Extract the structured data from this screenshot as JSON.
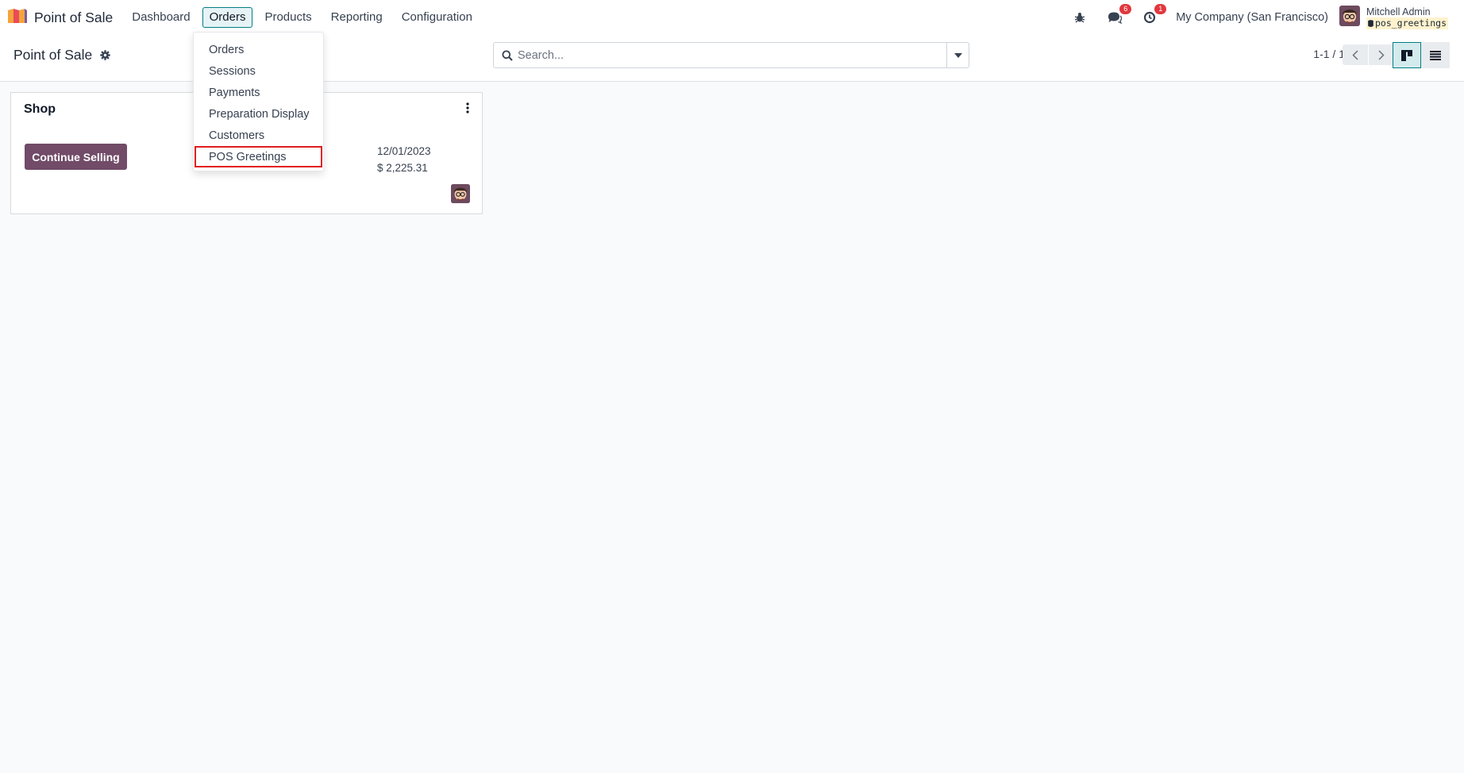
{
  "app": {
    "title": "Point of Sale",
    "logo": "pos-app-icon"
  },
  "menu": [
    {
      "label": "Dashboard",
      "active": false
    },
    {
      "label": "Orders",
      "active": true
    },
    {
      "label": "Products",
      "active": false
    },
    {
      "label": "Reporting",
      "active": false
    },
    {
      "label": "Configuration",
      "active": false
    }
  ],
  "systray": {
    "debug_icon": "bug-icon",
    "messages_icon": "chat-icon",
    "messages_count": "6",
    "activity_icon": "clock-icon",
    "activity_count": "1",
    "company": "My Company (San Francisco)",
    "user_name": "Mitchell Admin",
    "database": "pos_greetings"
  },
  "control_panel": {
    "title": "Point of Sale",
    "search_placeholder": "Search...",
    "pager": "1-1 / 1",
    "views": [
      "kanban",
      "list"
    ],
    "active_view": "kanban"
  },
  "orders_dropdown": {
    "items": [
      "Orders",
      "Sessions",
      "Payments",
      "Preparation Display",
      "Customers",
      "POS Greetings"
    ],
    "highlighted": "POS Greetings"
  },
  "card": {
    "title": "Shop",
    "action_label": "Continue Selling",
    "date": "12/01/2023",
    "amount": "$ 2,225.31"
  },
  "colors": {
    "primary": "#714b67",
    "accent": "#017e84",
    "badge": "#e0383e",
    "highlight": "#e11d1d"
  }
}
